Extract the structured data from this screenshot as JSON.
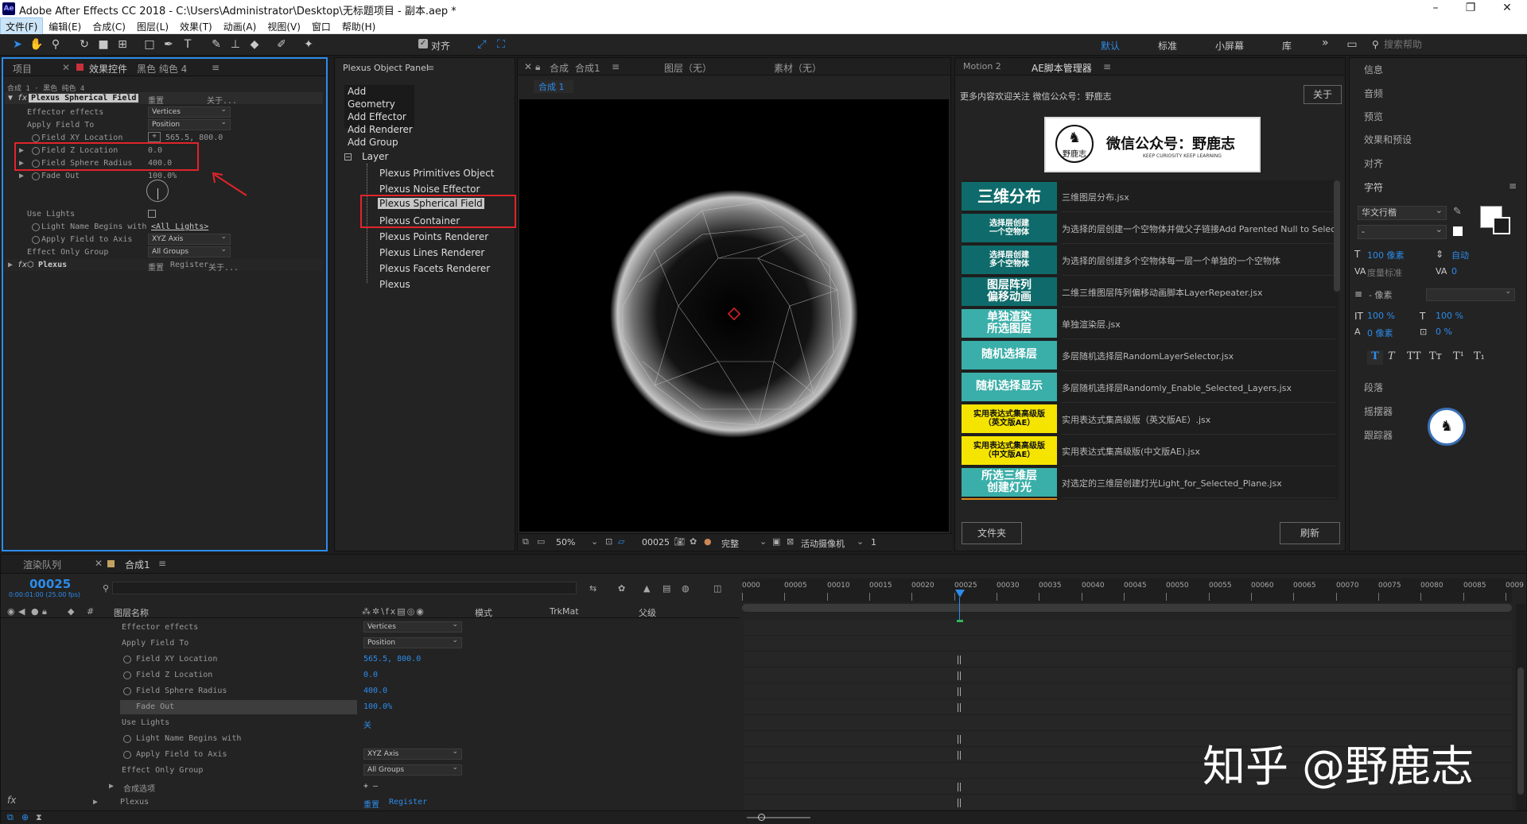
{
  "app": {
    "title": "Adobe After Effects CC 2018 - C:\\Users\\Administrator\\Desktop\\无标题项目 - 副本.aep *",
    "icon_label": "Ae"
  },
  "window_controls": {
    "minimize": "–",
    "maximize": "❐",
    "close": "✕"
  },
  "menu": [
    "文件(F)",
    "编辑(E)",
    "合成(C)",
    "图层(L)",
    "效果(T)",
    "动画(A)",
    "视图(V)",
    "窗口",
    "帮助(H)"
  ],
  "toolbar": {
    "align_label": "对齐",
    "workspaces": [
      "默认",
      "标准",
      "小屏幕",
      "库"
    ],
    "more": "»",
    "search_placeholder": "搜索帮助"
  },
  "left_panel": {
    "tab_project": "项目",
    "tab_effects": "效果控件",
    "tab_effects_layer": "黑色 纯色 4",
    "menu_icon": "≡",
    "breadcrumb": "合成 1 · 黑色 纯色 4",
    "effect1": {
      "fx": "fx",
      "name": "Plexus Spherical Field",
      "reset": "重置",
      "about": "关于..."
    },
    "props": [
      {
        "label": "Effector effects",
        "value": "Vertices",
        "kind": "dropdown"
      },
      {
        "label": "Apply Field To",
        "value": "Position",
        "kind": "dropdown"
      },
      {
        "label": "Field XY Location",
        "value": "565.5, 800.0",
        "kind": "value"
      },
      {
        "label": "Field Z Location",
        "value": "0.0",
        "kind": "value"
      },
      {
        "label": "Field Sphere Radius",
        "value": "400.0",
        "kind": "value"
      },
      {
        "label": "Fade Out",
        "value": "100.0%",
        "kind": "value"
      },
      {
        "label": "Use Lights",
        "value": "",
        "kind": "checkbox"
      },
      {
        "label": "Light Name Begins with",
        "value": "<All Lights>",
        "kind": "value"
      },
      {
        "label": "Apply Field to Axis",
        "value": "XYZ Axis",
        "kind": "dropdown"
      },
      {
        "label": "Effect Only Group",
        "value": "All Groups",
        "kind": "dropdown"
      }
    ],
    "effect2": {
      "fx": "fx",
      "name": "Plexus",
      "reset": "重置",
      "register": "Register",
      "about": "关于..."
    }
  },
  "plexus_panel": {
    "title": "Plexus Object Panel",
    "menu_icon": "≡",
    "actions": [
      "Add Geometry",
      "Add Effector",
      "Add Renderer",
      "Add Group"
    ],
    "tree_root": "Layer",
    "tree_items": [
      "Plexus Primitives Object",
      "Plexus Noise Effector",
      "Plexus Spherical Field",
      "Plexus Container",
      "Plexus Points Renderer",
      "Plexus Lines Renderer",
      "Plexus Facets Renderer",
      "Plexus"
    ]
  },
  "comp_panel": {
    "tab_comp": "合成",
    "tab_comp_name": "合成1",
    "tab_layer": "图层（无）",
    "tab_footage": "素材（无）",
    "subtab": "合成 1",
    "zoom": "50%",
    "timecode": "00025",
    "quality": "完整",
    "camera": "活动摄像机",
    "views": "1"
  },
  "script_panel": {
    "tab_motion": "Motion 2",
    "tab_manager": "AE脚本管理器",
    "notice": "更多内容欢迎关注 微信公众号：野鹿志",
    "about_btn": "关于",
    "banner_title": "微信公众号：野鹿志",
    "banner_sub": "KEEP CURIOSITY KEEP LEARNING",
    "banner_logo_text": "野鹿志",
    "scripts": [
      {
        "btn": "三维分布",
        "desc": "三维图层分布.jsx",
        "color": "#0f6b6b",
        "fg": "#ffffff"
      },
      {
        "btn": "选择层创建\n一个空物体",
        "desc": "为选择的层创建一个空物体并做父子链接Add Parented Null to Selected",
        "color": "#0f6b6b",
        "fg": "#ffffff"
      },
      {
        "btn": "选择层创建\n多个空物体",
        "desc": "为选择的层创建多个空物体每一层一个单独的一个空物体",
        "color": "#0f6b6b",
        "fg": "#ffffff"
      },
      {
        "btn": "图层阵列\n偏移动画",
        "desc": "二维三维图层阵列偏移动画脚本LayerRepeater.jsx",
        "color": "#0f6b6b",
        "fg": "#ffffff"
      },
      {
        "btn": "单独渲染\n所选图层",
        "desc": "单独渲染层.jsx",
        "color": "#3aaea8",
        "fg": "#ffffff"
      },
      {
        "btn": "随机选择层",
        "desc": "多层随机选择层RandomLayerSelector.jsx",
        "color": "#3aaea8",
        "fg": "#ffffff"
      },
      {
        "btn": "随机选择显示",
        "desc": "多层随机选择层Randomly_Enable_Selected_Layers.jsx",
        "color": "#3aaea8",
        "fg": "#ffffff"
      },
      {
        "btn": "实用表达式集高级版\n（英文版AE）",
        "desc": "实用表达式集高级版（英文版AE）.jsx",
        "color": "#f5e400",
        "fg": "#111111"
      },
      {
        "btn": "实用表达式集高级版\n（中文版AE）",
        "desc": "实用表达式集高级版(中文版AE).jsx",
        "color": "#f5e400",
        "fg": "#111111"
      },
      {
        "btn": "所选三维层\n创建灯光",
        "desc": "对选定的三维层创建灯光Light_for_Selected_Plane.jsx",
        "color": "#3aaea8",
        "fg": "#ffffff"
      }
    ],
    "folder_btn": "文件夹",
    "refresh_btn": "刷新"
  },
  "right_panel": {
    "items": [
      "信息",
      "音频",
      "预览",
      "效果和预设",
      "对齐"
    ],
    "char_title": "字符",
    "font": "华文行楷",
    "font_style": "-",
    "size": "100 像素",
    "leading": "自动",
    "kerning": "度量标准",
    "tracking": "0",
    "stroke": "- 像素",
    "vscale": "100 %",
    "hscale": "100 %",
    "baseline": "0 像素",
    "tsume": "0 %",
    "type_styles": [
      "T",
      "T",
      "TT",
      "Tт",
      "T¹",
      "T₁"
    ],
    "items2": [
      "段落",
      "摇摆器",
      "跟踪器"
    ]
  },
  "timeline": {
    "tab_render": "渲染队列",
    "tab_comp": "合成1",
    "timecode": "00025",
    "fps": "0:00:01:00 (25.00 fps)",
    "col_name": "图层名称",
    "col_mode": "模式",
    "col_trkmat": "TrkMat",
    "col_parent": "父级",
    "ticks": [
      "0000",
      "00005",
      "00010",
      "00015",
      "00020",
      "00025",
      "00030",
      "00035",
      "00040",
      "00045",
      "00050",
      "00055",
      "00060",
      "00065",
      "00070",
      "00075",
      "00080",
      "00085",
      "0009"
    ],
    "props": [
      {
        "label": "Effector effects",
        "value": "Vertices",
        "kind": "dropdown"
      },
      {
        "label": "Apply Field To",
        "value": "Position",
        "kind": "dropdown"
      },
      {
        "label": "Field XY Location",
        "value": "565.5, 800.0",
        "kind": "value"
      },
      {
        "label": "Field Z Location",
        "value": "0.0",
        "kind": "value"
      },
      {
        "label": "Field Sphere Radius",
        "value": "400.0",
        "kind": "value"
      },
      {
        "label": "Fade Out",
        "value": "100.0%",
        "kind": "value"
      },
      {
        "label": "Use Lights",
        "value": "关",
        "kind": "value"
      },
      {
        "label": "Light Name Begins with",
        "value": "",
        "kind": "value"
      },
      {
        "label": "Apply Field to Axis",
        "value": "XYZ Axis",
        "kind": "dropdown"
      },
      {
        "label": "Effect Only Group",
        "value": "All Groups",
        "kind": "dropdown"
      },
      {
        "label": "合成选项",
        "value": "+ —",
        "kind": "value"
      },
      {
        "label": "Plexus",
        "value": "重置",
        "kind": "value"
      }
    ],
    "register": "Register"
  },
  "watermark": "知乎 @野鹿志"
}
